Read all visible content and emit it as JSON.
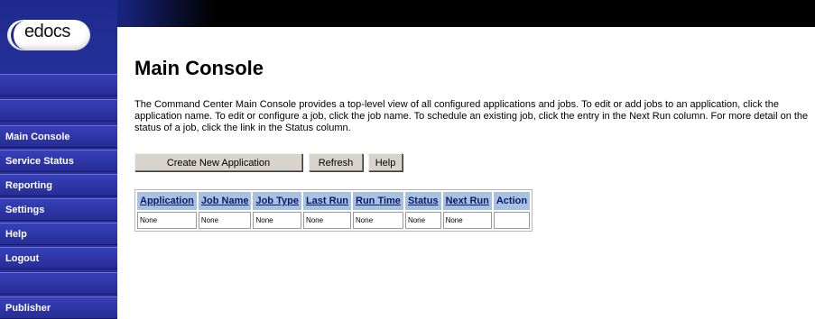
{
  "logo": {
    "text": "edocs"
  },
  "sidebar": {
    "items": [
      {
        "label": ""
      },
      {
        "label": ""
      },
      {
        "label": "Main Console"
      },
      {
        "label": "Service Status"
      },
      {
        "label": "Reporting"
      },
      {
        "label": "Settings"
      },
      {
        "label": "Help"
      },
      {
        "label": "Logout"
      },
      {
        "label": ""
      },
      {
        "label": "Publisher"
      }
    ]
  },
  "main": {
    "title": "Main Console",
    "description": "The Command Center Main Console provides a top-level view of all configured applications and jobs. To edit or add jobs to an application, click the application name. To edit or configure a job, click the job name. To schedule an existing job, click the entry in the Next Run column. For more detail on the status of a job, click the link in the Status column.",
    "buttons": {
      "create": "Create New Application",
      "refresh": "Refresh",
      "help": "Help"
    },
    "table": {
      "headers": [
        "Application",
        "Job Name",
        "Job Type",
        "Last Run",
        "Run Time",
        "Status",
        "Next Run",
        "Action"
      ],
      "rows": [
        [
          "None",
          "None",
          "None",
          "None",
          "None",
          "None",
          "None",
          ""
        ]
      ]
    }
  }
}
